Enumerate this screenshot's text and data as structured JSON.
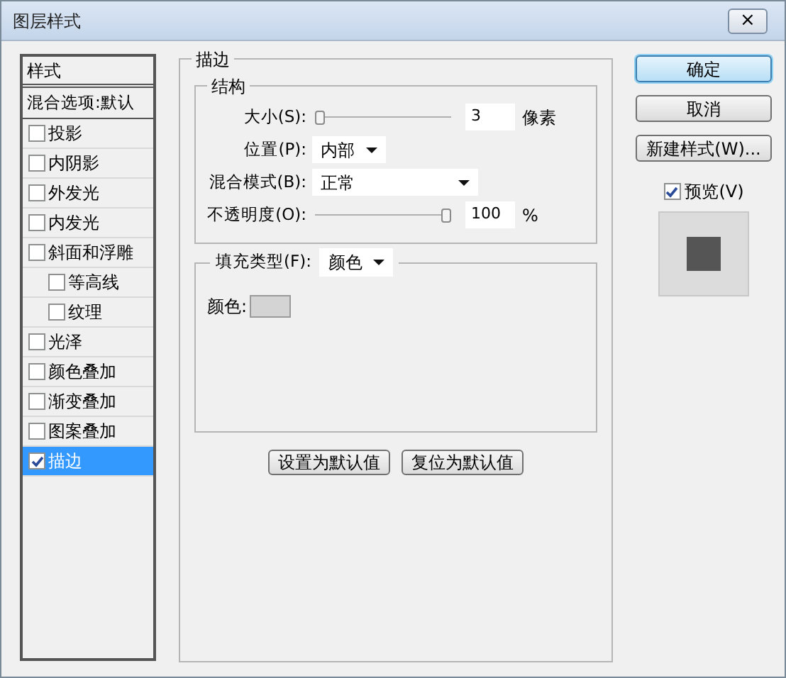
{
  "window": {
    "title": "图层样式",
    "close_label": "×"
  },
  "sidebar": {
    "header": "样式",
    "blend_options": "混合选项:默认",
    "items": [
      {
        "label": "投影",
        "checked": false,
        "selected": false
      },
      {
        "label": "内阴影",
        "checked": false,
        "selected": false
      },
      {
        "label": "外发光",
        "checked": false,
        "selected": false
      },
      {
        "label": "内发光",
        "checked": false,
        "selected": false
      },
      {
        "label": "斜面和浮雕",
        "checked": false,
        "selected": false,
        "children": [
          {
            "label": "等高线",
            "checked": false,
            "selected": false
          },
          {
            "label": "纹理",
            "checked": false,
            "selected": false
          }
        ]
      },
      {
        "label": "光泽",
        "checked": false,
        "selected": false
      },
      {
        "label": "颜色叠加",
        "checked": false,
        "selected": false
      },
      {
        "label": "渐变叠加",
        "checked": false,
        "selected": false
      },
      {
        "label": "图案叠加",
        "checked": false,
        "selected": false
      },
      {
        "label": "描边",
        "checked": true,
        "selected": true
      }
    ]
  },
  "stroke": {
    "title": "描边",
    "structure": {
      "title": "结构",
      "rows": [
        {
          "kind": "slider",
          "label": "大小(S):",
          "level": 0.0,
          "value": "3",
          "unit": "像素"
        },
        {
          "kind": "dropdown",
          "label": "位置(P):",
          "value": "内部",
          "wide": false
        },
        {
          "kind": "dropdown",
          "label": "混合模式(B):",
          "value": "正常",
          "wide": true
        },
        {
          "kind": "slider",
          "label": "不透明度(O):",
          "level": 1.0,
          "value": "100",
          "unit": "%"
        }
      ]
    },
    "fill": {
      "label": "填充类型(F):",
      "value": "颜色",
      "color_label": "颜色:",
      "color": "#d4d4d4"
    },
    "buttons": [
      "设置为默认值",
      "复位为默认值"
    ]
  },
  "actions": {
    "buttons": [
      {
        "label": "确定",
        "default": true
      },
      {
        "label": "取消",
        "default": false
      },
      {
        "label": "新建样式(W)..."
      }
    ],
    "preview": {
      "label": "预览(V)",
      "checked": true
    }
  }
}
